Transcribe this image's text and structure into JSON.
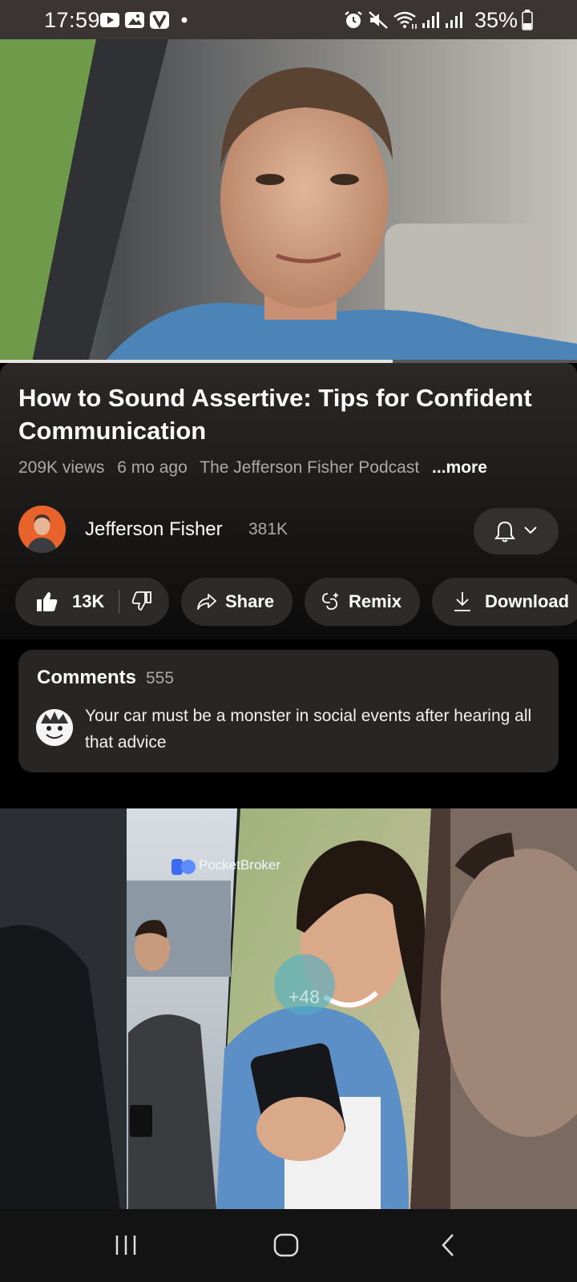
{
  "status_bar": {
    "time": "17:59",
    "battery": "35%",
    "icons": [
      "youtube-icon",
      "gallery-icon",
      "vpn-v-icon",
      "dot-icon",
      "alarm-icon",
      "mute-icon",
      "wifi-icon",
      "signal-icon",
      "signal-icon",
      "battery-icon"
    ]
  },
  "video": {
    "title": "How to Sound Assertive: Tips for Confident Communication",
    "views": "209K views",
    "age": "6 mo ago",
    "podcast": "The Jefferson Fisher Podcast",
    "more": "...more",
    "progress_fraction": 0.68
  },
  "channel": {
    "name": "Jefferson Fisher",
    "subscribers": "381K"
  },
  "actions": {
    "like_count": "13K",
    "share": "Share",
    "remix": "Remix",
    "download": "Download"
  },
  "comments": {
    "heading": "Comments",
    "count": "555",
    "top_comment": "Your car must be a monster in social events after hearing all that advice"
  },
  "ad": {
    "brand": "PocketBroker",
    "badge": "+48"
  },
  "colors": {
    "status_bar": "#3a3533",
    "chip_bg": "#2d2b2a",
    "card_bg": "#272625",
    "avatar_orange": "#e8622c",
    "muted_text": "#aaaaaa"
  }
}
